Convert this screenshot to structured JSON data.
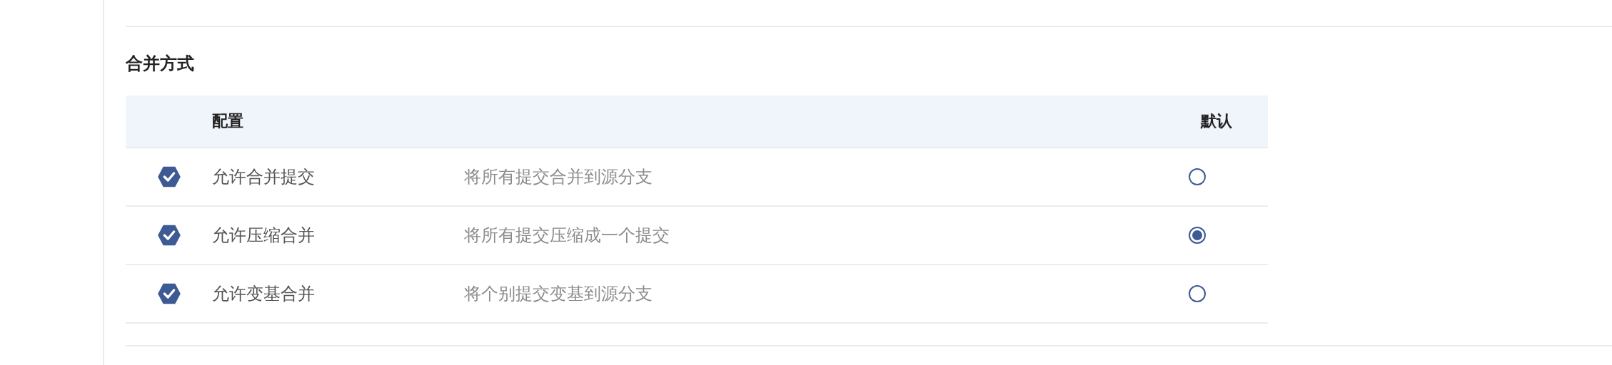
{
  "section": {
    "title": "合并方式"
  },
  "table": {
    "columns": [
      {
        "label": "配置"
      },
      {
        "label": "默认"
      }
    ],
    "rows": [
      {
        "checked": true,
        "label": "允许合并提交",
        "description": "将所有提交合并到源分支",
        "selected": false
      },
      {
        "checked": true,
        "label": "允许压缩合并",
        "description": "将所有提交压缩成一个提交",
        "selected": true
      },
      {
        "checked": true,
        "label": "允许变基合并",
        "description": "将个别提交变基到源分支",
        "selected": false
      }
    ]
  }
}
